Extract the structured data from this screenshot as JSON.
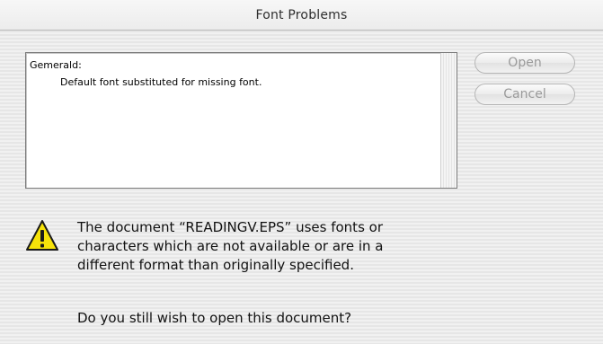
{
  "window": {
    "title": "Font Problems"
  },
  "problems_list": {
    "font_name": "Gemerald:",
    "detail": "Default font substituted for missing font."
  },
  "buttons": {
    "open_label": "Open",
    "cancel_label": "Cancel"
  },
  "message": {
    "text": "The document “READINGV.EPS” uses fonts or characters which are not available or are in a different format than originally specified.",
    "question": "Do you still wish to open this document?"
  },
  "icons": {
    "warning": "warning-triangle-icon"
  },
  "colors": {
    "warning_fill": "#f6e20a",
    "disabled_button_text": "#9a9a9a"
  }
}
